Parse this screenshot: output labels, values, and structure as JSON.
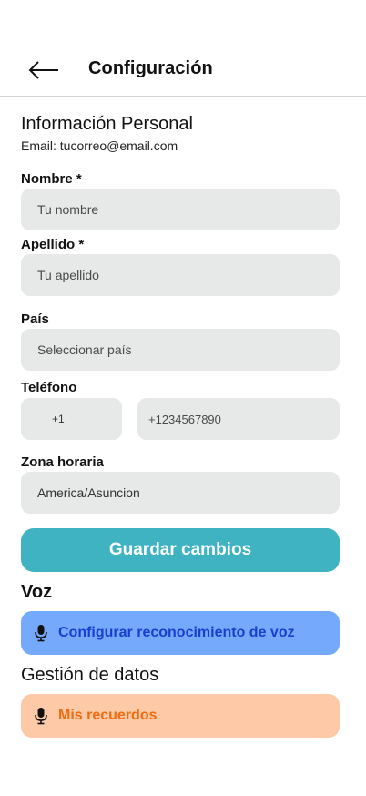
{
  "header": {
    "title": "Configuración",
    "back_icon": "arrow-left-icon"
  },
  "personal": {
    "title": "Información Personal",
    "email_line": "Email: tucorreo@email.com"
  },
  "form": {
    "nombre": {
      "label": "Nombre *",
      "placeholder": "Tu nombre"
    },
    "apellido": {
      "label": "Apellido *",
      "placeholder": "Tu apellido"
    },
    "pais": {
      "label": "País",
      "placeholder": "Seleccionar país"
    },
    "telefono": {
      "label": "Teléfono",
      "code_value": "+1",
      "number_placeholder": "+1234567890"
    },
    "zona": {
      "label": "Zona horaria",
      "value": "America/Asuncion"
    }
  },
  "save_button": "Guardar cambios",
  "voice": {
    "title": "Voz",
    "button_label": "Configurar reconocimiento de voz",
    "icon": "microphone-icon"
  },
  "data_management": {
    "title": "Gestión de datos",
    "button_label": "Mis recuerdos",
    "icon": "microphone-icon"
  },
  "colors": {
    "save_button_bg": "#3fb3c2",
    "voice_button_bg": "#74a9fb",
    "voice_button_text": "#1a3fd0",
    "memories_button_bg": "#fdc9a6",
    "memories_button_text": "#f06c10",
    "input_bg": "#e7e9e8"
  }
}
